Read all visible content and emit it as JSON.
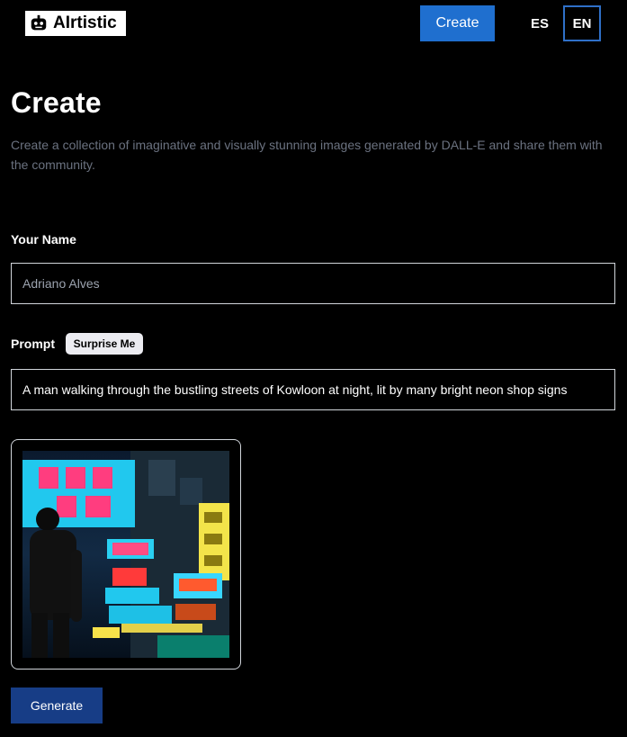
{
  "header": {
    "logo_text": "AIrtistic",
    "logo_icon": "robot-icon",
    "create_label": "Create",
    "languages": [
      "ES",
      "EN"
    ],
    "active_language": "EN"
  },
  "page": {
    "title": "Create",
    "description": "Create a collection of imaginative and visually stunning images generated by DALL-E and share them with the community."
  },
  "form": {
    "name_label": "Your Name",
    "name_value": "Adriano Alves",
    "prompt_label": "Prompt",
    "surprise_label": "Surprise Me",
    "prompt_value": "A man walking through the bustling streets of Kowloon at night, lit by many bright neon shop signs"
  },
  "preview": {
    "image_subject": "man walking among neon shop signs in Kowloon at night"
  },
  "actions": {
    "generate_label": "Generate"
  },
  "colors": {
    "background": "#000000",
    "primary": "#1f6fcf",
    "generate": "#173d86",
    "muted_text": "#6b7280"
  }
}
